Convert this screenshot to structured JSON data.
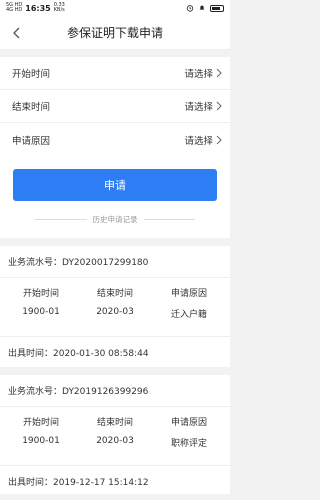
{
  "status": {
    "net_left": "5G HD",
    "net_left2": "4G HD",
    "time": "16:35",
    "speed": "0.33",
    "speed_unit": "KB/s",
    "battery_percent": 80
  },
  "nav": {
    "title": "参保证明下载申请"
  },
  "form": {
    "rows": [
      {
        "label": "开始时间",
        "value": "请选择"
      },
      {
        "label": "结束时间",
        "value": "请选择"
      },
      {
        "label": "申请原因",
        "value": "请选择"
      }
    ]
  },
  "apply_label": "申请",
  "history_label": "历史申请记录",
  "records": [
    {
      "serial": "业务流水号：DY2020017299180",
      "headers": [
        "开始时间",
        "结束时间",
        "申请原因"
      ],
      "values": [
        "1900-01",
        "2020-03",
        "迁入户籍"
      ],
      "issued": "出具时间：2020-01-30 08:58:44"
    },
    {
      "serial": "业务流水号：DY2019126399296",
      "headers": [
        "开始时间",
        "结束时间",
        "申请原因"
      ],
      "values": [
        "1900-01",
        "2020-03",
        "职称评定"
      ],
      "issued": "出具时间：2019-12-17 15:14:12"
    }
  ]
}
